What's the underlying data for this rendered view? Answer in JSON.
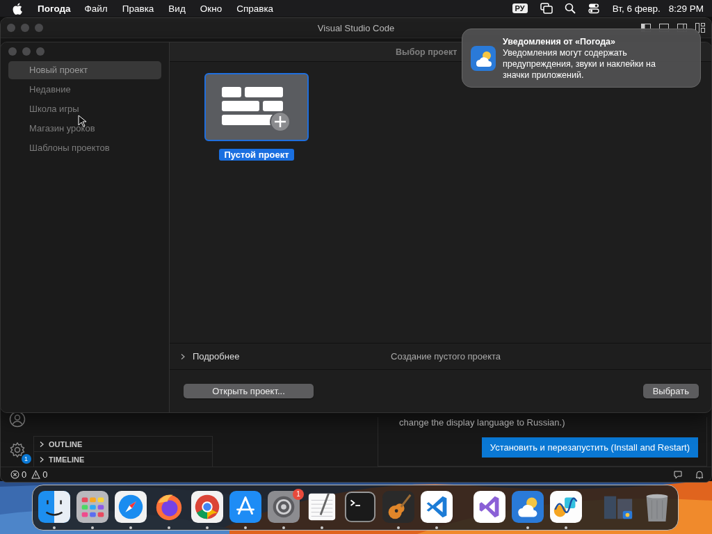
{
  "menu_bar": {
    "app": "Погода",
    "menus": [
      "Файл",
      "Правка",
      "Вид",
      "Окно",
      "Справка"
    ],
    "input_source": "РУ",
    "date": "Вт, 6 февр.",
    "time": "8:29 PM"
  },
  "window": {
    "title": "Visual Studio Code"
  },
  "activity_bar": {
    "settings_badge": "1"
  },
  "side_panels": [
    {
      "label": "OUTLINE",
      "expanded": false
    },
    {
      "label": "TIMELINE",
      "expanded": false
    }
  ],
  "editor_card": {
    "text": "change the display language to Russian.)",
    "button": "Установить и перезапустить (Install and Restart)"
  },
  "status_bar": {
    "errors": "0",
    "warnings": "0"
  },
  "dialog": {
    "title": "Выбор проект",
    "categories": [
      {
        "label": "Новый проект",
        "selected": true
      },
      {
        "label": "Недавние",
        "selected": false
      },
      {
        "label": "Школа игры",
        "selected": false
      },
      {
        "label": "Магазин уроков",
        "selected": false
      },
      {
        "label": "Шаблоны проектов",
        "selected": false
      }
    ],
    "templates": [
      {
        "label": "Пустой проект",
        "selected": true
      }
    ],
    "details_label": "Подробнее",
    "details_expanded": false,
    "description": "Создание пустого проекта",
    "open_button": "Открыть проект...",
    "choose_button": "Выбрать"
  },
  "notification": {
    "title": "Уведомления от «Погода»",
    "body": "Уведомления могут содержать предупреждения, звуки и наклейки на значки приложений."
  },
  "dock": {
    "groups": [
      [
        {
          "kind": "finder",
          "running": true
        },
        {
          "kind": "launchpad",
          "running": true
        },
        {
          "kind": "safari",
          "running": true
        },
        {
          "kind": "firefox",
          "running": true
        },
        {
          "kind": "chrome",
          "running": true
        },
        {
          "kind": "appstore",
          "running": true
        },
        {
          "kind": "settings",
          "running": true,
          "badge": "1"
        },
        {
          "kind": "textedit",
          "running": true
        },
        {
          "kind": "terminal",
          "running": false
        },
        {
          "kind": "guitar",
          "running": true
        },
        {
          "kind": "vscode",
          "running": true
        }
      ],
      [
        {
          "kind": "vs",
          "running": false
        },
        {
          "kind": "weather",
          "running": true
        },
        {
          "kind": "freeform",
          "running": true
        }
      ],
      [
        {
          "kind": "stack",
          "running": false
        },
        {
          "kind": "trash",
          "running": false
        }
      ]
    ]
  }
}
